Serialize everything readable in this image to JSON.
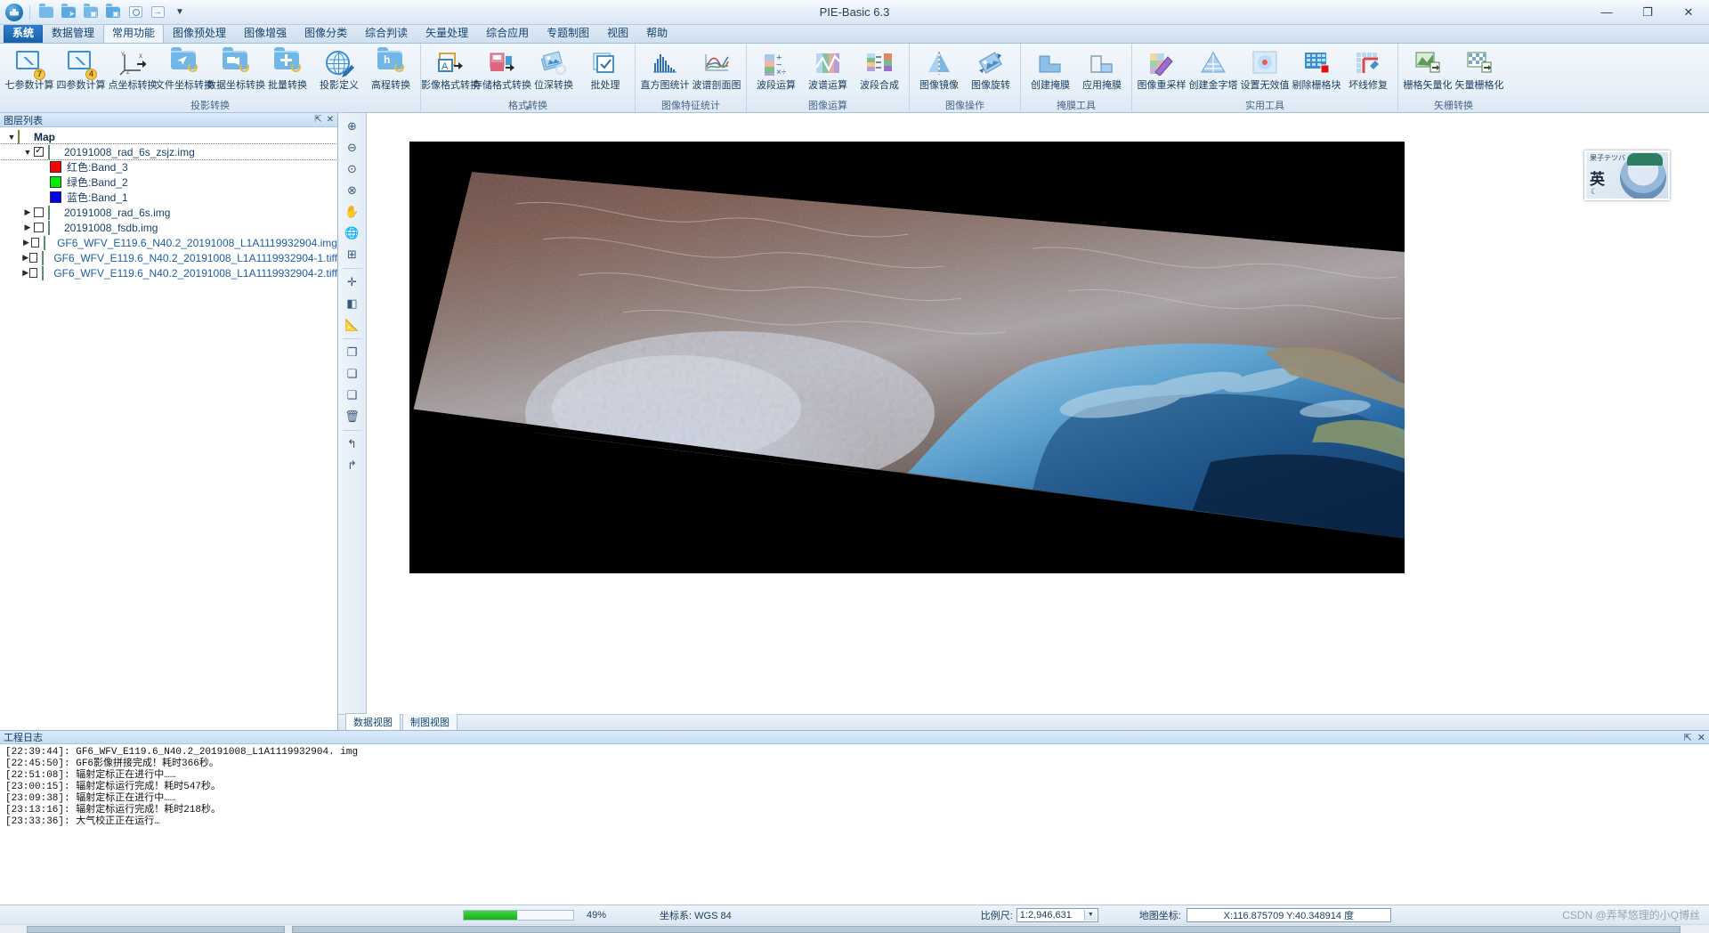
{
  "window": {
    "title": "PIE-Basic 6.3",
    "minimize": "—",
    "maximize": "❐",
    "close": "✕"
  },
  "quick_access": {
    "items": [
      {
        "name": "new-folder-button",
        "label": "New"
      },
      {
        "name": "open-folder-button",
        "label": "Open"
      },
      {
        "name": "save-folder-button",
        "label": "Save"
      },
      {
        "name": "save-as-folder-button",
        "label": "Save As"
      },
      {
        "name": "search-button",
        "label": "Search"
      },
      {
        "name": "export-button",
        "label": "Export"
      },
      {
        "name": "customize-qat-button",
        "label": "▼"
      }
    ]
  },
  "ribbon": {
    "tabs": [
      {
        "label": "系统",
        "state": "highlight"
      },
      {
        "label": "数据管理",
        "state": "normal"
      },
      {
        "label": "常用功能",
        "state": "selected"
      },
      {
        "label": "图像预处理",
        "state": "normal"
      },
      {
        "label": "图像增强",
        "state": "normal"
      },
      {
        "label": "图像分类",
        "state": "normal"
      },
      {
        "label": "综合判读",
        "state": "normal"
      },
      {
        "label": "矢量处理",
        "state": "normal"
      },
      {
        "label": "综合应用",
        "state": "normal"
      },
      {
        "label": "专题制图",
        "state": "normal"
      },
      {
        "label": "视图",
        "state": "normal"
      },
      {
        "label": "帮助",
        "state": "normal"
      }
    ],
    "groups": [
      {
        "label": "投影转换",
        "has_more": false,
        "buttons": [
          {
            "label": "七参数计算",
            "icon": "monitor-chart-7-icon"
          },
          {
            "label": "四参数计算",
            "icon": "monitor-chart-4-icon"
          },
          {
            "label": "点坐标转换",
            "icon": "axes-transform-icon"
          },
          {
            "label": "文件坐标转换",
            "icon": "folder-arrow-icon"
          },
          {
            "label": "数据坐标转换",
            "icon": "folder-data-icon"
          },
          {
            "label": "批量转换",
            "icon": "folder-plus-icon"
          },
          {
            "label": "投影定义",
            "icon": "globe-pencil-icon"
          },
          {
            "label": "高程转换",
            "icon": "folder-height-icon"
          }
        ]
      },
      {
        "label": "格式转换",
        "has_more": true,
        "buttons": [
          {
            "label": "影像格式转换",
            "icon": "image-format-icon"
          },
          {
            "label": "存储格式转换",
            "icon": "storage-format-icon"
          },
          {
            "label": "位深转换",
            "icon": "bit-depth-icon"
          },
          {
            "label": "批处理",
            "icon": "batch-check-icon"
          }
        ]
      },
      {
        "label": "图像特征统计",
        "has_more": false,
        "buttons": [
          {
            "label": "直方图统计",
            "icon": "histogram-icon"
          },
          {
            "label": "波谱剖面图",
            "icon": "spectral-profile-icon"
          }
        ]
      },
      {
        "label": "图像运算",
        "has_more": false,
        "buttons": [
          {
            "label": "波段运算",
            "icon": "band-math-icon"
          },
          {
            "label": "波谱运算",
            "icon": "spectral-math-icon"
          },
          {
            "label": "波段合成",
            "icon": "band-composite-icon"
          }
        ]
      },
      {
        "label": "图像操作",
        "has_more": false,
        "buttons": [
          {
            "label": "图像镜像",
            "icon": "image-mirror-icon"
          },
          {
            "label": "图像旋转",
            "icon": "image-rotate-icon"
          }
        ]
      },
      {
        "label": "掩膜工具",
        "has_more": false,
        "buttons": [
          {
            "label": "创建掩膜",
            "icon": "create-mask-icon"
          },
          {
            "label": "应用掩膜",
            "icon": "apply-mask-icon"
          }
        ]
      },
      {
        "label": "实用工具",
        "has_more": false,
        "buttons": [
          {
            "label": "图像重采样",
            "icon": "resample-icon"
          },
          {
            "label": "创建金字塔",
            "icon": "pyramid-icon"
          },
          {
            "label": "设置无效值",
            "icon": "nodata-icon"
          },
          {
            "label": "剔除栅格块",
            "icon": "remove-raster-block-icon"
          },
          {
            "label": "坏线修复",
            "icon": "bad-line-repair-icon"
          }
        ]
      },
      {
        "label": "矢栅转换",
        "has_more": false,
        "buttons": [
          {
            "label": "栅格矢量化",
            "icon": "raster-to-vector-icon"
          },
          {
            "label": "矢量栅格化",
            "icon": "vector-to-raster-icon"
          }
        ]
      }
    ]
  },
  "layer_panel": {
    "title": "图层列表",
    "tools": [
      "⇱",
      "✕"
    ],
    "root": {
      "label": "Map",
      "expanded": true,
      "checked": true
    },
    "layers": [
      {
        "label": "20191008_rad_6s_zsjz.img",
        "checked": true,
        "expanded": true,
        "indent": 1,
        "selected": true,
        "bands": [
          {
            "label": "红色:Band_3",
            "color": "#ff0000"
          },
          {
            "label": "绿色:Band_2",
            "color": "#00ee00"
          },
          {
            "label": "蓝色:Band_1",
            "color": "#0000ee"
          }
        ]
      },
      {
        "label": "20191008_rad_6s.img",
        "checked": false,
        "expanded": false,
        "indent": 1,
        "bands": []
      },
      {
        "label": "20191008_fsdb.img",
        "checked": false,
        "expanded": false,
        "indent": 1,
        "bands": []
      },
      {
        "label": "GF6_WFV_E119.6_N40.2_20191008_L1A1119932904.img",
        "checked": false,
        "expanded": false,
        "indent": 1,
        "bands": []
      },
      {
        "label": "GF6_WFV_E119.6_N40.2_20191008_L1A1119932904-1.tiff",
        "checked": false,
        "expanded": false,
        "indent": 1,
        "bands": []
      },
      {
        "label": "GF6_WFV_E119.6_N40.2_20191008_L1A1119932904-2.tiff",
        "checked": false,
        "expanded": false,
        "indent": 1,
        "bands": []
      }
    ]
  },
  "view_tools": [
    {
      "name": "zoom-in-tool",
      "glyph": "⊕"
    },
    {
      "name": "zoom-out-tool",
      "glyph": "⊖"
    },
    {
      "name": "zoom-to-layer-tool",
      "glyph": "⊙"
    },
    {
      "name": "zoom-fit-tool",
      "glyph": "⊗"
    },
    {
      "name": "pan-tool",
      "glyph": "✋"
    },
    {
      "name": "globe-tool",
      "glyph": "🌐"
    },
    {
      "name": "roam-tool",
      "glyph": "⊞"
    },
    {
      "name": "crosshair-tool",
      "glyph": "✛"
    },
    {
      "name": "flicker-tool",
      "glyph": "◧"
    },
    {
      "name": "measure-tool",
      "glyph": "📐"
    },
    {
      "name": "copy-view-tool",
      "glyph": "❐"
    },
    {
      "name": "layer-view-tool",
      "glyph": "❏"
    },
    {
      "name": "clip-view-tool",
      "glyph": "❑"
    },
    {
      "name": "delete-tool",
      "glyph": "🗑"
    },
    {
      "name": "undo-tool",
      "glyph": "↰"
    },
    {
      "name": "redo-tool",
      "glyph": "↱"
    }
  ],
  "view_tabs": [
    {
      "label": "数据视图",
      "active": true
    },
    {
      "label": "制图视图",
      "active": false
    }
  ],
  "canvas": {
    "avatar": {
      "top_text": "果子テツバ",
      "main_text": "英",
      "moon": "☾"
    }
  },
  "log_panel": {
    "title": "工程日志",
    "tools": [
      "⇱",
      "✕"
    ],
    "lines": [
      "[22:39:44]: GF6_WFV_E119.6_N40.2_20191008_L1A1119932904. img",
      "[22:45:50]: GF6影像拼接完成！耗时366秒。",
      "[22:51:08]: 辐射定标正在进行中……",
      "[23:00:15]: 辐射定标运行完成！耗时547秒。",
      "[23:09:38]: 辐射定标正在进行中……",
      "[23:13:16]: 辐射定标运行完成！耗时218秒。",
      "[23:33:36]: 大气校正正在运行…"
    ]
  },
  "status_bar": {
    "progress_percent": "49%",
    "progress_value": 49,
    "crs_label": "坐标系: WGS 84",
    "scale_label": "比例尺:",
    "scale_value": "1:2,946,631",
    "geo_label": "地图坐标:",
    "geo_value": "X:116.875709 Y:40.348914 度",
    "watermark": "CSDN @弄琴悠理的小Q博丝"
  }
}
